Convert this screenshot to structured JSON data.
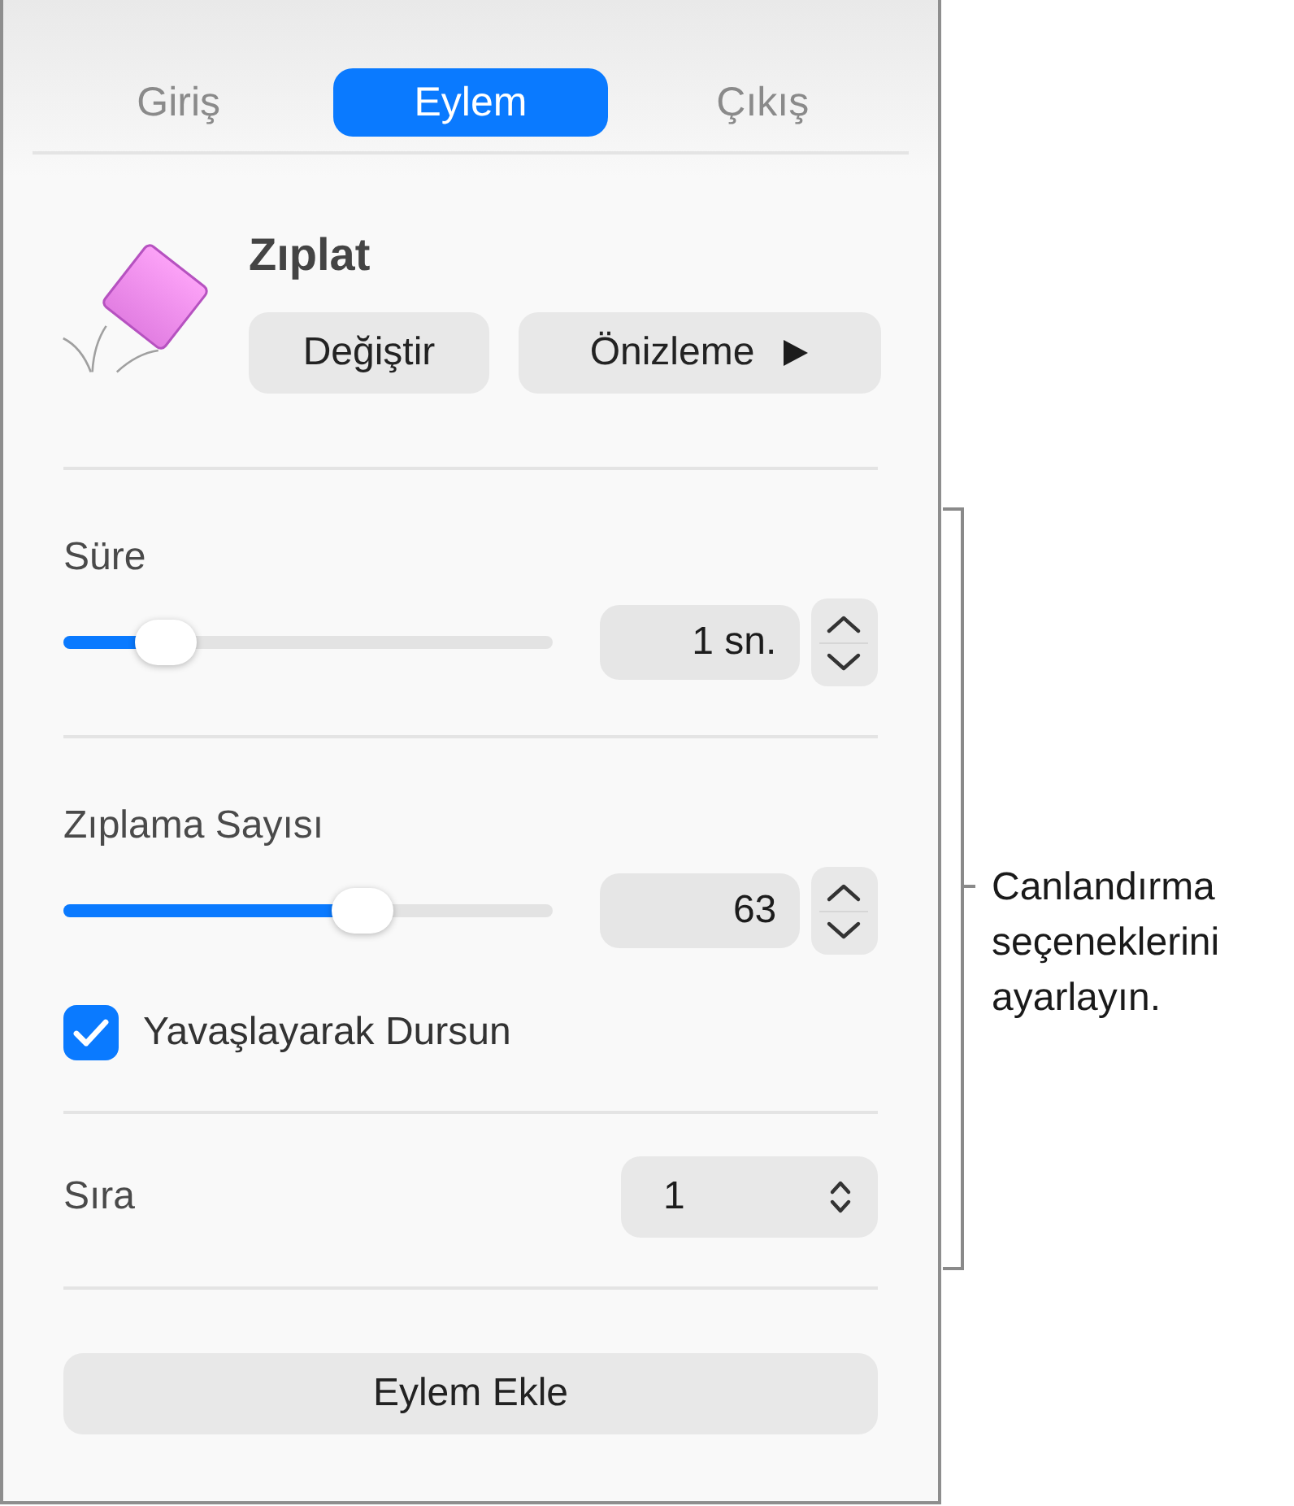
{
  "tabs": [
    {
      "label": "Giriş",
      "selected": false
    },
    {
      "label": "Eylem",
      "selected": true
    },
    {
      "label": "Çıkış",
      "selected": false
    }
  ],
  "effect": {
    "name": "Zıplat",
    "change_button": "Değiştir",
    "preview_button": "Önizleme"
  },
  "sections": [
    {
      "rows": [
        {
          "kind": "slider",
          "label": "Süre",
          "level": 0.21,
          "value": "1 sn."
        }
      ]
    },
    {
      "rows": [
        {
          "kind": "slider",
          "label": "Zıplama Sayısı",
          "level": 0.61,
          "value": "63"
        },
        {
          "kind": "checkbox",
          "label": "Yavaşlayarak Dursun",
          "checked": true
        }
      ]
    },
    {
      "rows": [
        {
          "kind": "popup",
          "label": "Sıra",
          "value": "1"
        }
      ]
    }
  ],
  "add_button": "Eylem Ekle",
  "callout": "Canlandırma seçeneklerini ayarlayın."
}
